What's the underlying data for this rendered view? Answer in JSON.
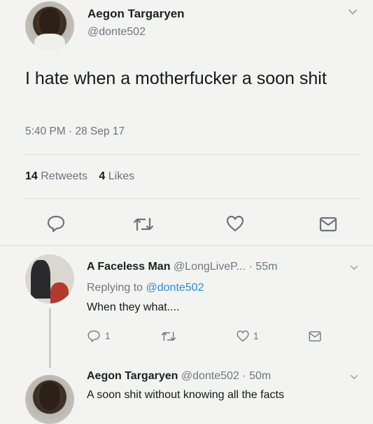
{
  "main_tweet": {
    "author_name": "Aegon Targaryen",
    "author_handle": "@donte502",
    "text": "I hate when a motherfucker a soon shit",
    "timestamp": "5:40 PM · 28 Sep 17",
    "retweets_count": "14",
    "retweets_label": "Retweets",
    "likes_count": "4",
    "likes_label": "Likes",
    "actions": [
      "reply-icon",
      "retweet-icon",
      "like-icon",
      "message-icon"
    ]
  },
  "reply_1": {
    "author_name": "A Faceless Man",
    "author_handle": "@LongLiveP...",
    "time": "· 55m",
    "replying_prefix": "Replying to",
    "replying_mention": "@donte502",
    "text": "When they what....",
    "reply_count": "1",
    "like_count": "1"
  },
  "reply_2": {
    "author_name": "Aegon Targaryen",
    "author_handle": "@donte502",
    "time": "· 50m",
    "text": "A soon shit without knowing all the facts"
  },
  "colors": {
    "background": "#f3f4f2",
    "text": "#15181b",
    "secondary": "#6b737c",
    "mention": "#2b8dd9"
  }
}
